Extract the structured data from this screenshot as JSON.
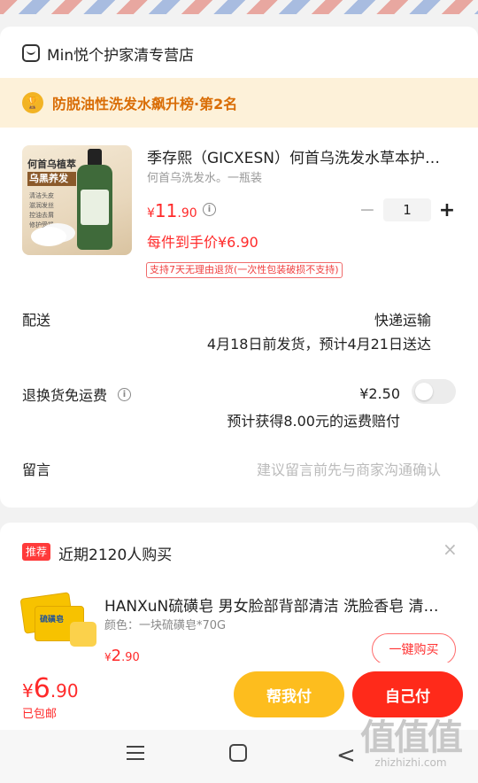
{
  "store": {
    "name": "Min悦个护家清专营店"
  },
  "rank": {
    "text": "防脱油性洗发水飙升榜·第2名"
  },
  "product": {
    "image_title_line1": "何首乌植萃",
    "image_title_line2": "乌黑养发",
    "image_bullets": "清洁头皮\n滋润发丝\n控油去屑\n修护受损",
    "title": "季存熙（GICXESN）何首乌洗发水草本护…",
    "sku": "何首乌洗发水。一瓶装",
    "price_symbol": "¥",
    "price_int": "11",
    "price_dec": ".90",
    "quantity": "1",
    "per_price": "每件到手价¥6.90",
    "return_policy": "支持7天无理由退货(一次性包装破损不支持)"
  },
  "delivery": {
    "label": "配送",
    "method": "快递运输",
    "schedule": "4月18日前发货，预计4月21日送达"
  },
  "return_insurance": {
    "label": "退换货免运费",
    "price": "¥2.50",
    "note": "预计获得8.00元的运费赔付",
    "enabled": false
  },
  "memo": {
    "label": "留言",
    "placeholder": "建议留言前先与商家沟通确认"
  },
  "recommend": {
    "badge": "推荐",
    "title": "近期2120人购买",
    "close": "×",
    "item": {
      "image_text": "硫磺皂",
      "name": "HANXuN硫磺皂 男女脸部背部清洁 洗脸香皂 清…",
      "spec": "颜色：一块硫磺皂*70G",
      "price_symbol": "¥",
      "price_int": "2",
      "price_dec": ".90",
      "buy_label": "一键购买"
    }
  },
  "checkout": {
    "total_symbol": "¥",
    "total_int": "6",
    "total_dec": ".90",
    "shipping_note": "已包邮",
    "help_pay_label": "帮我付",
    "self_pay_label": "自己付"
  },
  "watermark": {
    "big": "值值值",
    "small": "zhizhizhi.com"
  },
  "colors": {
    "accent_red": "#ff2a1a",
    "accent_yellow": "#fdbd1e",
    "rank_bg": "#fdf1d9",
    "rank_text": "#d96d06"
  }
}
